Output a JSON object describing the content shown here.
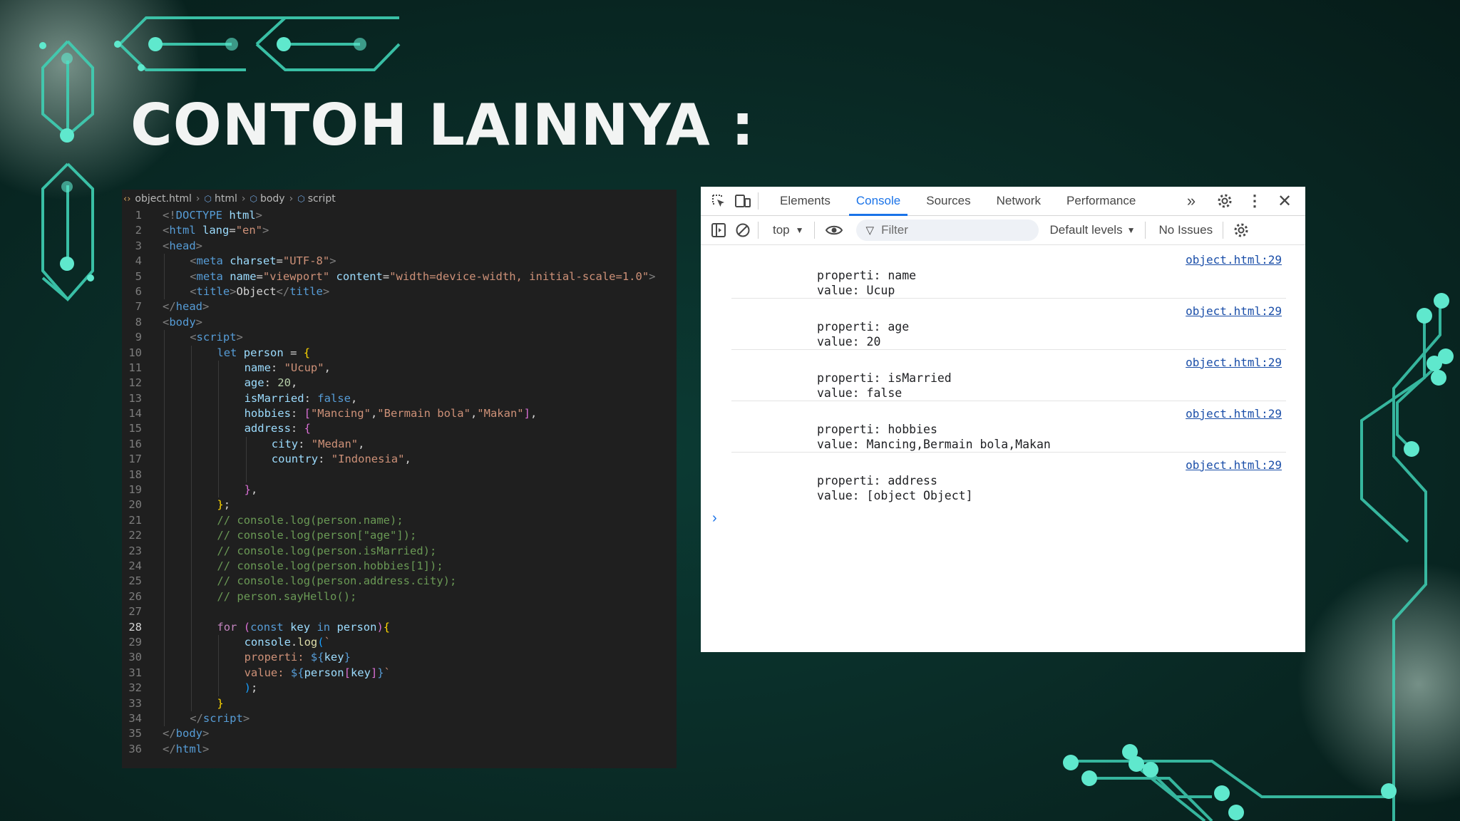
{
  "slide": {
    "title": "CONTOH LAINNYA :"
  },
  "editor": {
    "breadcrumb": [
      "object.html",
      "html",
      "body",
      "script"
    ],
    "active_line": 28,
    "lines": [
      {
        "n": "1",
        "indent": 0,
        "tokens": [
          [
            "p",
            "<!"
          ],
          [
            "t",
            "DOCTYPE"
          ],
          [
            "w",
            " "
          ],
          [
            "a",
            "html"
          ],
          [
            "p",
            ">"
          ]
        ]
      },
      {
        "n": "2",
        "indent": 0,
        "tokens": [
          [
            "p",
            "<"
          ],
          [
            "t",
            "html"
          ],
          [
            "w",
            " "
          ],
          [
            "a",
            "lang"
          ],
          [
            "w",
            "="
          ],
          [
            "s",
            "\"en\""
          ],
          [
            "p",
            ">"
          ]
        ]
      },
      {
        "n": "3",
        "indent": 0,
        "tokens": [
          [
            "p",
            "<"
          ],
          [
            "t",
            "head"
          ],
          [
            "p",
            ">"
          ]
        ]
      },
      {
        "n": "4",
        "indent": 1,
        "tokens": [
          [
            "p",
            "<"
          ],
          [
            "t",
            "meta"
          ],
          [
            "w",
            " "
          ],
          [
            "a",
            "charset"
          ],
          [
            "w",
            "="
          ],
          [
            "s",
            "\"UTF-8\""
          ],
          [
            "p",
            ">"
          ]
        ]
      },
      {
        "n": "5",
        "indent": 1,
        "tokens": [
          [
            "p",
            "<"
          ],
          [
            "t",
            "meta"
          ],
          [
            "w",
            " "
          ],
          [
            "a",
            "name"
          ],
          [
            "w",
            "="
          ],
          [
            "s",
            "\"viewport\""
          ],
          [
            "w",
            " "
          ],
          [
            "a",
            "content"
          ],
          [
            "w",
            "="
          ],
          [
            "s",
            "\"width=device-width, initial-scale=1.0\""
          ],
          [
            "p",
            ">"
          ]
        ]
      },
      {
        "n": "6",
        "indent": 1,
        "tokens": [
          [
            "p",
            "<"
          ],
          [
            "t",
            "title"
          ],
          [
            "p",
            ">"
          ],
          [
            "w",
            "Object"
          ],
          [
            "p",
            "</"
          ],
          [
            "t",
            "title"
          ],
          [
            "p",
            ">"
          ]
        ]
      },
      {
        "n": "7",
        "indent": 0,
        "tokens": [
          [
            "p",
            "</"
          ],
          [
            "t",
            "head"
          ],
          [
            "p",
            ">"
          ]
        ]
      },
      {
        "n": "8",
        "indent": 0,
        "tokens": [
          [
            "p",
            "<"
          ],
          [
            "t",
            "body"
          ],
          [
            "p",
            ">"
          ]
        ]
      },
      {
        "n": "9",
        "indent": 1,
        "tokens": [
          [
            "p",
            "<"
          ],
          [
            "t",
            "script"
          ],
          [
            "p",
            ">"
          ]
        ]
      },
      {
        "n": "10",
        "indent": 2,
        "tokens": [
          [
            "k",
            "let"
          ],
          [
            "w",
            " "
          ],
          [
            "v",
            "person"
          ],
          [
            "w",
            " = "
          ],
          [
            "b",
            "{"
          ]
        ]
      },
      {
        "n": "11",
        "indent": 3,
        "tokens": [
          [
            "v",
            "name"
          ],
          [
            "w",
            ": "
          ],
          [
            "s",
            "\"Ucup\""
          ],
          [
            "w",
            ","
          ]
        ]
      },
      {
        "n": "12",
        "indent": 3,
        "tokens": [
          [
            "v",
            "age"
          ],
          [
            "w",
            ": "
          ],
          [
            "n",
            "20"
          ],
          [
            "w",
            ","
          ]
        ]
      },
      {
        "n": "13",
        "indent": 3,
        "tokens": [
          [
            "v",
            "isMarried"
          ],
          [
            "w",
            ": "
          ],
          [
            "k",
            "false"
          ],
          [
            "w",
            ","
          ]
        ]
      },
      {
        "n": "14",
        "indent": 3,
        "tokens": [
          [
            "v",
            "hobbies"
          ],
          [
            "w",
            ": "
          ],
          [
            "b2",
            "["
          ],
          [
            "s",
            "\"Mancing\""
          ],
          [
            "w",
            ","
          ],
          [
            "s",
            "\"Bermain bola\""
          ],
          [
            "w",
            ","
          ],
          [
            "s",
            "\"Makan\""
          ],
          [
            "b2",
            "]"
          ],
          [
            "w",
            ","
          ]
        ]
      },
      {
        "n": "15",
        "indent": 3,
        "tokens": [
          [
            "v",
            "address"
          ],
          [
            "w",
            ": "
          ],
          [
            "b2",
            "{"
          ]
        ]
      },
      {
        "n": "16",
        "indent": 4,
        "tokens": [
          [
            "v",
            "city"
          ],
          [
            "w",
            ": "
          ],
          [
            "s",
            "\"Medan\""
          ],
          [
            "w",
            ","
          ]
        ]
      },
      {
        "n": "17",
        "indent": 4,
        "tokens": [
          [
            "v",
            "country"
          ],
          [
            "w",
            ": "
          ],
          [
            "s",
            "\"Indonesia\""
          ],
          [
            "w",
            ","
          ]
        ]
      },
      {
        "n": "18",
        "indent": 4,
        "tokens": []
      },
      {
        "n": "19",
        "indent": 3,
        "tokens": [
          [
            "b2",
            "}"
          ],
          [
            "w",
            ","
          ]
        ]
      },
      {
        "n": "20",
        "indent": 2,
        "tokens": [
          [
            "b",
            "}"
          ],
          [
            "w",
            ";"
          ]
        ]
      },
      {
        "n": "21",
        "indent": 2,
        "tokens": [
          [
            "c",
            "// console.log(person.name);"
          ]
        ]
      },
      {
        "n": "22",
        "indent": 2,
        "tokens": [
          [
            "c",
            "// console.log(person[\"age\"]);"
          ]
        ]
      },
      {
        "n": "23",
        "indent": 2,
        "tokens": [
          [
            "c",
            "// console.log(person.isMarried);"
          ]
        ]
      },
      {
        "n": "24",
        "indent": 2,
        "tokens": [
          [
            "c",
            "// console.log(person.hobbies[1]);"
          ]
        ]
      },
      {
        "n": "25",
        "indent": 2,
        "tokens": [
          [
            "c",
            "// console.log(person.address.city);"
          ]
        ]
      },
      {
        "n": "26",
        "indent": 2,
        "tokens": [
          [
            "c",
            "// person.sayHello();"
          ]
        ]
      },
      {
        "n": "27",
        "indent": 2,
        "tokens": []
      },
      {
        "n": "28",
        "indent": 2,
        "tokens": [
          [
            "x",
            "for"
          ],
          [
            "w",
            " "
          ],
          [
            "b2",
            "("
          ],
          [
            "k",
            "const"
          ],
          [
            "w",
            " "
          ],
          [
            "v",
            "key"
          ],
          [
            "w",
            " "
          ],
          [
            "k",
            "in"
          ],
          [
            "w",
            " "
          ],
          [
            "v",
            "person"
          ],
          [
            "b2",
            ")"
          ],
          [
            "b",
            "{"
          ]
        ]
      },
      {
        "n": "29",
        "indent": 3,
        "tokens": [
          [
            "v",
            "console"
          ],
          [
            "w",
            "."
          ],
          [
            "f",
            "log"
          ],
          [
            "b3",
            "("
          ],
          [
            "s",
            "`"
          ]
        ]
      },
      {
        "n": "30",
        "indent": 3,
        "tokens": [
          [
            "s",
            "properti: "
          ],
          [
            "k",
            "${"
          ],
          [
            "v",
            "key"
          ],
          [
            "k",
            "}"
          ]
        ]
      },
      {
        "n": "31",
        "indent": 3,
        "tokens": [
          [
            "s",
            "value: "
          ],
          [
            "k",
            "${"
          ],
          [
            "v",
            "person"
          ],
          [
            "b2",
            "["
          ],
          [
            "v",
            "key"
          ],
          [
            "b2",
            "]"
          ],
          [
            "k",
            "}"
          ],
          [
            "s",
            "`"
          ]
        ]
      },
      {
        "n": "32",
        "indent": 3,
        "tokens": [
          [
            "b3",
            ")"
          ],
          [
            "w",
            ";"
          ]
        ]
      },
      {
        "n": "33",
        "indent": 2,
        "tokens": [
          [
            "b",
            "}"
          ]
        ]
      },
      {
        "n": "34",
        "indent": 1,
        "tokens": [
          [
            "p",
            "</"
          ],
          [
            "t",
            "script"
          ],
          [
            "p",
            ">"
          ]
        ]
      },
      {
        "n": "35",
        "indent": 0,
        "tokens": [
          [
            "p",
            "</"
          ],
          [
            "t",
            "body"
          ],
          [
            "p",
            ">"
          ]
        ]
      },
      {
        "n": "36",
        "indent": 0,
        "tokens": [
          [
            "p",
            "</"
          ],
          [
            "t",
            "html"
          ],
          [
            "p",
            ">"
          ]
        ]
      }
    ]
  },
  "devtools": {
    "tabs": [
      "Elements",
      "Console",
      "Sources",
      "Network",
      "Performance"
    ],
    "active_tab": "Console",
    "context": "top",
    "filter_placeholder": "Filter",
    "levels": "Default levels",
    "issues": "No Issues",
    "accent": "#1a73e8",
    "entries": [
      {
        "link": "object.html:29",
        "message": "properti: name\nvalue: Ucup"
      },
      {
        "link": "object.html:29",
        "message": "properti: age\nvalue: 20"
      },
      {
        "link": "object.html:29",
        "message": "properti: isMarried\nvalue: false"
      },
      {
        "link": "object.html:29",
        "message": "properti: hobbies\nvalue: Mancing,Bermain bola,Makan"
      },
      {
        "link": "object.html:29",
        "message": "properti: address\nvalue: [object Object]"
      }
    ]
  }
}
